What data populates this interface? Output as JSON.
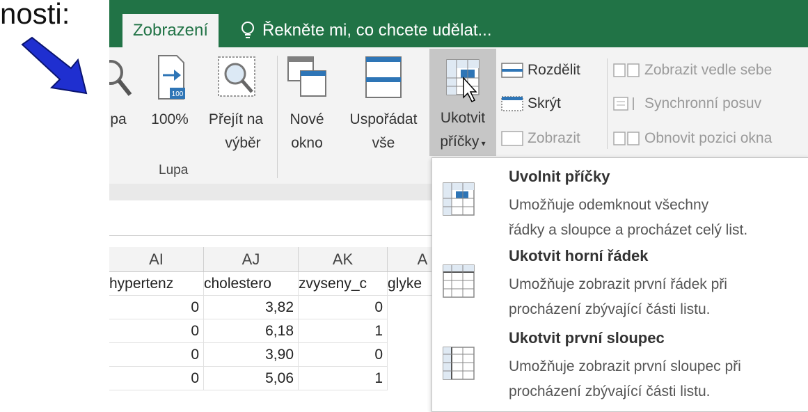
{
  "corner_text": "nosti:",
  "tabs": {
    "active": "Zobrazení",
    "tellme": "Řekněte mi, co chcete udělat..."
  },
  "ribbon": {
    "zoom_partial": "pa",
    "zoom100": "100%",
    "goto_line1": "Přejít na",
    "goto_line2": "výběr",
    "new_window_line1": "Nové",
    "new_window_line2": "okno",
    "arrange_line1": "Uspořádat",
    "arrange_line2": "vše",
    "freeze_line1": "Ukotvit",
    "freeze_line2": "příčky",
    "split": "Rozdělit",
    "hide": "Skrýt",
    "unhide": "Zobrazit",
    "side_by_side": "Zobrazit vedle sebe",
    "sync_scroll": "Synchronní posuv",
    "reset_position": "Obnovit pozici okna",
    "group_lupa": "Lupa",
    "icon_100_label": "100"
  },
  "sheet": {
    "columns": [
      "AI",
      "AJ",
      "AK",
      "A"
    ],
    "header_row": [
      "hypertenz",
      "cholestero",
      "zvyseny_c",
      "glyke"
    ],
    "rows": [
      [
        "0",
        "3,82",
        "0"
      ],
      [
        "0",
        "6,18",
        "1"
      ],
      [
        "0",
        "3,90",
        "0"
      ],
      [
        "0",
        "5,06",
        "1"
      ]
    ]
  },
  "dropdown": {
    "items": [
      {
        "title": "Uvolnit příčky",
        "desc1": "Umožňuje odemknout všechny",
        "desc2": "řádky a sloupce a procházet celý list."
      },
      {
        "title": "Ukotvit horní řádek",
        "desc1": "Umožňuje zobrazit první řádek při",
        "desc2": "procházení zbývající části listu."
      },
      {
        "title": "Ukotvit první sloupec",
        "desc1": "Umožňuje zobrazit první sloupec při",
        "desc2": "procházení zbývající části listu."
      }
    ]
  },
  "colors": {
    "excel_green": "#217346",
    "annotation_arrow": "#1f2fd0"
  }
}
